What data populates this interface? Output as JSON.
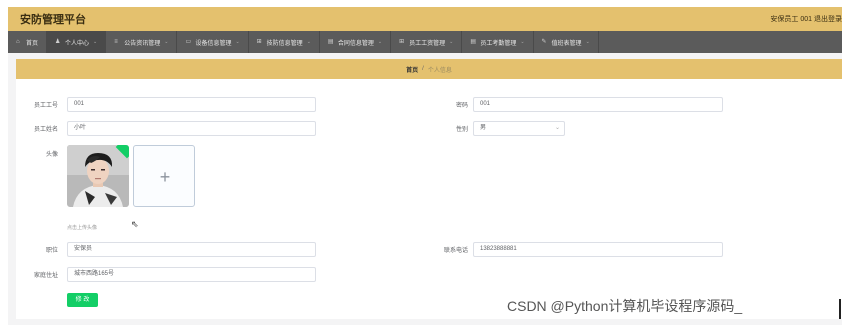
{
  "header": {
    "app_title": "安防管理平台",
    "user_info": "安保员工 001",
    "logout": "退出登录"
  },
  "nav": {
    "items": [
      {
        "label": "首页",
        "icon": "home-icon",
        "glyph": "⌂"
      },
      {
        "label": "个人中心",
        "icon": "user-icon",
        "glyph": "♟"
      },
      {
        "label": "公告资讯管理",
        "icon": "list-icon",
        "glyph": "≡"
      },
      {
        "label": "设备信息管理",
        "icon": "chat-icon",
        "glyph": "▭"
      },
      {
        "label": "技防信息管理",
        "icon": "grid-icon",
        "glyph": "⊞"
      },
      {
        "label": "合同信息管理",
        "icon": "doc-icon",
        "glyph": "▤"
      },
      {
        "label": "员工工资管理",
        "icon": "grid-icon",
        "glyph": "⊞"
      },
      {
        "label": "员工考勤管理",
        "icon": "doc-icon",
        "glyph": "▤"
      },
      {
        "label": "值班表管理",
        "icon": "tool-icon",
        "glyph": "✎"
      }
    ]
  },
  "breadcrumb": {
    "home": "首页",
    "separator": "/",
    "current": "个人信息"
  },
  "form": {
    "employee_no_label": "员工工号",
    "employee_no_value": "001",
    "password_label": "密码",
    "password_value": "001",
    "employee_name_label": "员工姓名",
    "employee_name_value": "小叶",
    "gender_label": "性别",
    "gender_value": "男",
    "avatar_label": "头像",
    "avatar_tip": "点击上传头像",
    "position_label": "职位",
    "position_value": "安保员",
    "phone_label": "联系电话",
    "phone_value": "13823888881",
    "address_label": "家庭住址",
    "address_value": "城市西路165号",
    "submit_label": "修 改"
  },
  "watermark": "CSDN @Python计算机毕设程序源码_",
  "colors": {
    "header_bg": "#e4c16e",
    "nav_bg": "#5b5b5b",
    "button_bg": "#13ce66"
  }
}
